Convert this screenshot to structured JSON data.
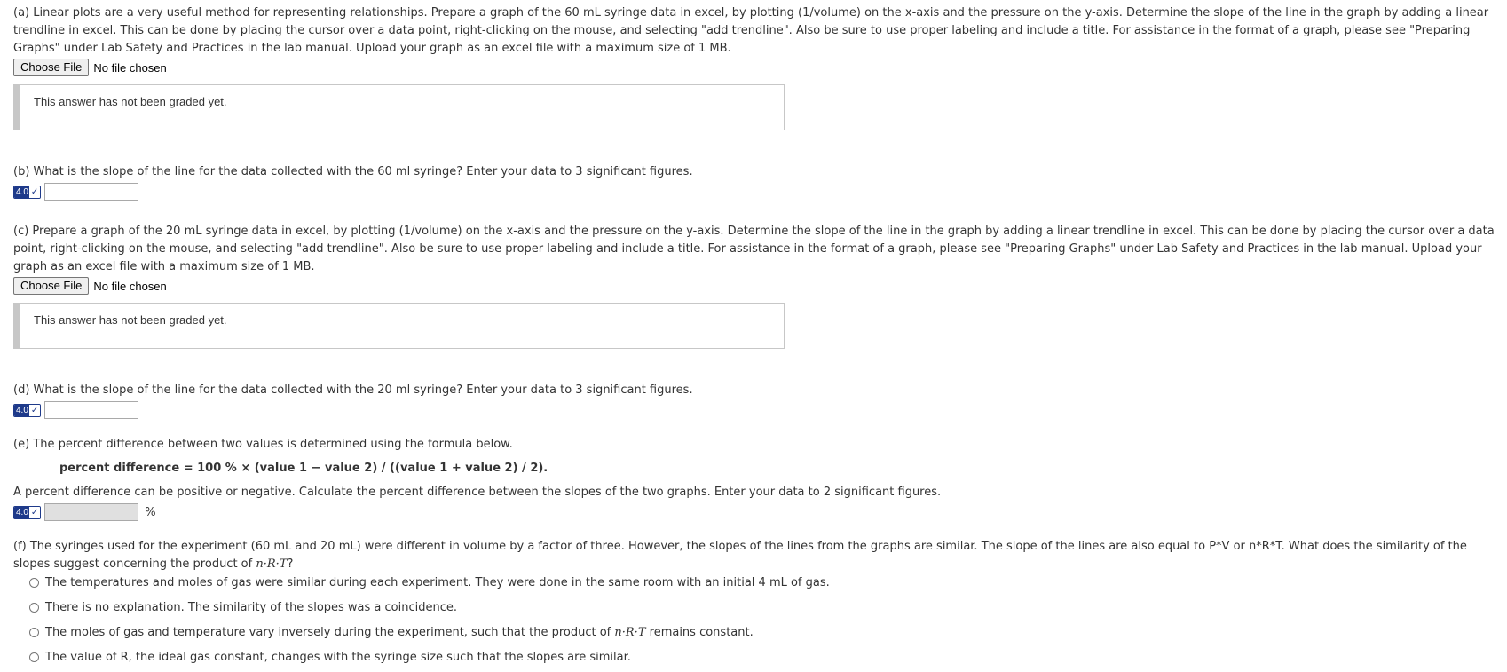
{
  "part_a": {
    "text": "(a) Linear plots are a very useful method for representing relationships. Prepare a graph of the 60 mL syringe data in excel, by plotting (1/volume) on the x-axis and the pressure on the y-axis. Determine the slope of the line in the graph by adding a linear trendline in excel. This can be done by placing the cursor over a data point, right-clicking on the mouse, and selecting \"add trendline\". Also be sure to use proper labeling and include a title. For assistance in the format of a graph, please see \"Preparing Graphs\" under Lab Safety and Practices in the lab manual. Upload your graph as an excel file with a maximum size of 1 MB.",
    "file_button": "Choose File",
    "file_status": "No file chosen",
    "graded_text": "This answer has not been graded yet."
  },
  "part_b": {
    "text": "(b) What is the slope of the line for the data collected with the 60 ml syringe? Enter your data to 3 significant figures.",
    "points": "4.0",
    "input_value": ""
  },
  "part_c": {
    "text": "(c) Prepare a graph of the 20 mL syringe data in excel, by plotting (1/volume) on the x-axis and the pressure on the y-axis. Determine the slope of the line in the graph by adding a linear trendline in excel. This can be done by placing the cursor over a data point, right-clicking on the mouse, and selecting \"add trendline\". Also be sure to use proper labeling and include a title. For assistance in the format of a graph, please see \"Preparing Graphs\" under Lab Safety and Practices in the lab manual. Upload your graph as an excel file with a maximum size of 1 MB.",
    "file_button": "Choose File",
    "file_status": "No file chosen",
    "graded_text": "This answer has not been graded yet."
  },
  "part_d": {
    "text": "(d) What is the slope of the line for the data collected with the 20 ml syringe? Enter your data to 3 significant figures.",
    "points": "4.0",
    "input_value": ""
  },
  "part_e": {
    "text": "(e) The percent difference between two values is determined using the formula below.",
    "formula": "percent difference = 100 % × (value 1 − value 2) / ((value 1 + value 2) / 2).",
    "instruction": "A percent difference can be positive or negative. Calculate the percent difference between the slopes of the two graphs. Enter your data to 2 significant figures.",
    "points": "4.0",
    "input_value": "",
    "unit": "%"
  },
  "part_f": {
    "text_before": "(f) The syringes used for the experiment (60 mL and 20 mL) were different in volume by a factor of three. However, the slopes of the lines from the graphs are similar. The slope of the lines are also equal to P*V or n*R*T. What does the similarity of the slopes suggest concerning the product of ",
    "math_expr": "n·R·T",
    "text_after": "?",
    "options": [
      {
        "text": "The temperatures and moles of gas were similar during each experiment. They were done in the same room with an initial 4 mL of gas."
      },
      {
        "text": "There is no explanation. The similarity of the slopes was a coincidence."
      },
      {
        "text_before": "The moles of gas and temperature vary inversely during the experiment, such that the product of ",
        "math_expr": "n·R·T",
        "text_after": " remains constant."
      },
      {
        "text": "The value of R, the ideal gas constant, changes with the syringe size such that the slopes are similar."
      }
    ]
  }
}
